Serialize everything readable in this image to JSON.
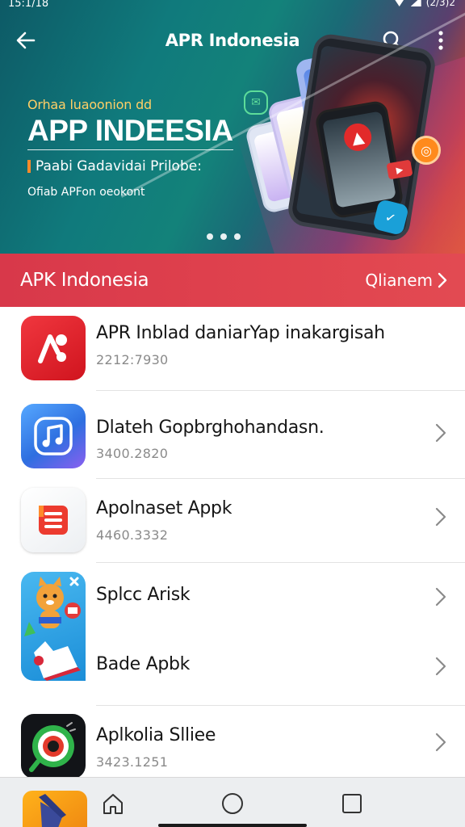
{
  "status_bar": {
    "time": "15:1/18",
    "battery": "(2/3)2"
  },
  "header": {
    "title": "APR Indonesia"
  },
  "banner": {
    "line1": "Orhaa luaoonion dd",
    "headline": "APP INDEESIA",
    "subline": "Paabi Gadavidai Prilobe:",
    "small": "Ofiab APFon oeokont",
    "slides": 3,
    "active_slide": 0
  },
  "section": {
    "title": "APK Indonesia",
    "link_label": "Qlianem"
  },
  "apps": [
    {
      "name": "APR Inblad daniarYap inakargisah",
      "meta": "2212:7930",
      "icon": "red-music-icon",
      "has_chevron": false
    },
    {
      "name": "Dlateh Gopbrghohandasn.",
      "meta": "3400.2820",
      "icon": "music-note-icon",
      "has_chevron": true
    },
    {
      "name": "Apolnaset Appk",
      "meta": "4460.3332",
      "icon": "list-document-icon",
      "has_chevron": true
    },
    {
      "name": "Splcc Arisk",
      "meta": "",
      "icon": "cartoon-fox-icon",
      "has_chevron": true
    },
    {
      "name": "Bade Apbk",
      "meta": "",
      "icon": "cartoon-fox-icon",
      "has_chevron": true
    },
    {
      "name": "Aplkolia Slliee",
      "meta": "3423.1251",
      "icon": "camera-lens-icon",
      "has_chevron": true
    }
  ],
  "nav": {
    "items": [
      "home-icon",
      "circle-icon",
      "square-icon"
    ]
  },
  "colors": {
    "accent_red": "#e0434e",
    "hero_teal": "#107a7c",
    "hero_orange": "#f05a1c",
    "text_gray": "#8a8a8a"
  }
}
